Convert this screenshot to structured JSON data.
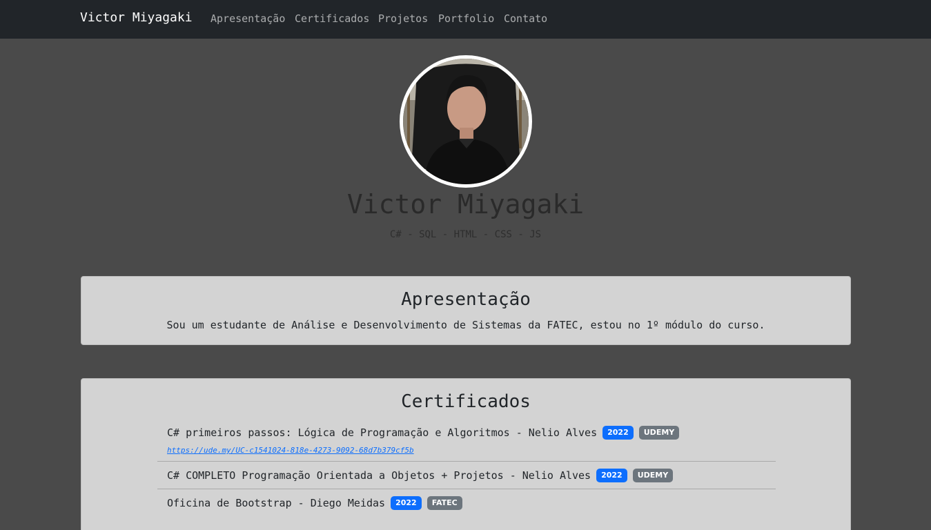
{
  "navbar": {
    "brand": "Victor Miyagaki",
    "links": [
      "Apresentação",
      "Certificados",
      "Projetos",
      "Portfolio",
      "Contato"
    ]
  },
  "hero": {
    "name": "Victor Miyagaki",
    "skills": "C# - SQL - HTML - CSS - JS"
  },
  "about": {
    "title": "Apresentação",
    "text": "Sou um estudante de Análise e Desenvolvimento de Sistemas da FATEC, estou no 1º módulo do curso."
  },
  "certificates": {
    "title": "Certificados",
    "items": [
      {
        "title": "C# primeiros passos: Lógica de Programação e Algoritmos - Nelio Alves",
        "year": "2022",
        "org": "UDEMY",
        "link": "https://ude.my/UC-c1541024-818e-4273-9092-68d7b379cf5b"
      },
      {
        "title": "C# COMPLETO Programação Orientada a Objetos + Projetos - Nelio Alves",
        "year": "2022",
        "org": "UDEMY"
      },
      {
        "title": "Oficina de Bootstrap - Diego Meidas",
        "year": "2022",
        "org": "FATEC"
      }
    ]
  },
  "colors": {
    "background": "#4a4a4a",
    "navbar": "#212529",
    "card": "#d3d3d3",
    "badge_year": "#0d6efd",
    "badge_org": "#6c757d"
  }
}
